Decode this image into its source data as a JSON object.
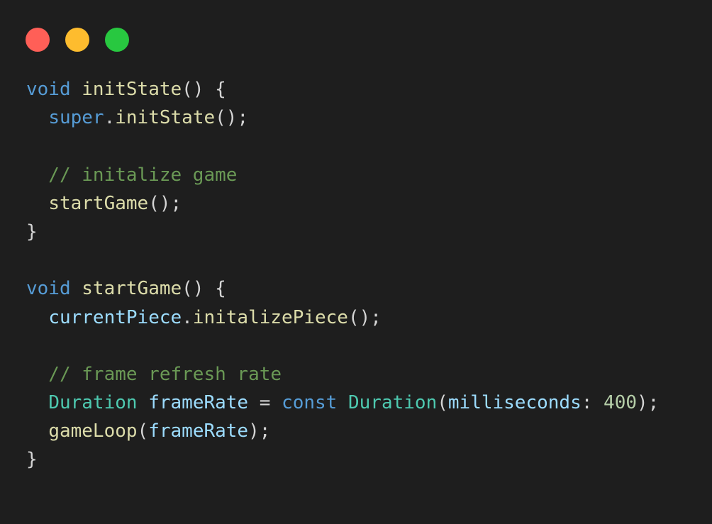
{
  "window": {
    "controls": [
      {
        "name": "close",
        "color": "#ff5f57"
      },
      {
        "name": "minimize",
        "color": "#febc2e"
      },
      {
        "name": "zoom",
        "color": "#28c840"
      }
    ]
  },
  "code": {
    "lines": [
      [
        {
          "t": "void",
          "c": "kw"
        },
        {
          "t": " ",
          "c": "pun"
        },
        {
          "t": "initState",
          "c": "fn"
        },
        {
          "t": "() {",
          "c": "pun"
        }
      ],
      [
        {
          "t": "  ",
          "c": "pun"
        },
        {
          "t": "super",
          "c": "kw"
        },
        {
          "t": ".",
          "c": "pun"
        },
        {
          "t": "initState",
          "c": "fn"
        },
        {
          "t": "();",
          "c": "pun"
        }
      ],
      [],
      [
        {
          "t": "  // initalize game",
          "c": "cmt"
        }
      ],
      [
        {
          "t": "  ",
          "c": "pun"
        },
        {
          "t": "startGame",
          "c": "fn"
        },
        {
          "t": "();",
          "c": "pun"
        }
      ],
      [
        {
          "t": "}",
          "c": "pun"
        }
      ],
      [],
      [
        {
          "t": "void",
          "c": "kw"
        },
        {
          "t": " ",
          "c": "pun"
        },
        {
          "t": "startGame",
          "c": "fn"
        },
        {
          "t": "() {",
          "c": "pun"
        }
      ],
      [
        {
          "t": "  ",
          "c": "pun"
        },
        {
          "t": "currentPiece",
          "c": "var"
        },
        {
          "t": ".",
          "c": "pun"
        },
        {
          "t": "initalizePiece",
          "c": "fn"
        },
        {
          "t": "();",
          "c": "pun"
        }
      ],
      [],
      [
        {
          "t": "  // frame refresh rate",
          "c": "cmt"
        }
      ],
      [
        {
          "t": "  ",
          "c": "pun"
        },
        {
          "t": "Duration",
          "c": "type"
        },
        {
          "t": " ",
          "c": "pun"
        },
        {
          "t": "frameRate",
          "c": "var"
        },
        {
          "t": " = ",
          "c": "pun"
        },
        {
          "t": "const",
          "c": "kw"
        },
        {
          "t": " ",
          "c": "pun"
        },
        {
          "t": "Duration",
          "c": "type"
        },
        {
          "t": "(",
          "c": "pun"
        },
        {
          "t": "milliseconds",
          "c": "var"
        },
        {
          "t": ": ",
          "c": "pun"
        },
        {
          "t": "400",
          "c": "num"
        },
        {
          "t": ");",
          "c": "pun"
        }
      ],
      [
        {
          "t": "  ",
          "c": "pun"
        },
        {
          "t": "gameLoop",
          "c": "fn"
        },
        {
          "t": "(",
          "c": "pun"
        },
        {
          "t": "frameRate",
          "c": "var"
        },
        {
          "t": ");",
          "c": "pun"
        }
      ],
      [
        {
          "t": "}",
          "c": "pun"
        }
      ]
    ]
  }
}
